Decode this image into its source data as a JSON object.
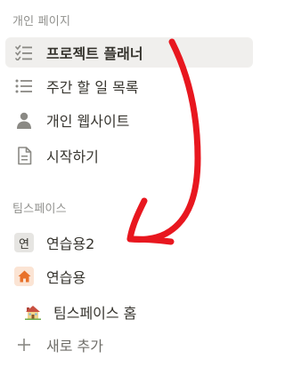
{
  "personal": {
    "title": "개인 페이지",
    "items": [
      {
        "label": "프로젝트 플래너",
        "icon": "checklist-icon"
      },
      {
        "label": "주간 할 일 목록",
        "icon": "bullet-list-icon"
      },
      {
        "label": "개인 웹사이트",
        "icon": "person-icon"
      },
      {
        "label": "시작하기",
        "icon": "document-icon"
      }
    ]
  },
  "teamspace": {
    "title": "팀스페이스",
    "items": [
      {
        "label": "연습용2",
        "icon": "teamspace-initial-badge-icon",
        "badge_text": "연"
      },
      {
        "label": "연습용",
        "icon": "house-badge-icon"
      },
      {
        "label": "팀스페이스 홈",
        "icon": "home-emoji-icon"
      },
      {
        "label": "새로 추가",
        "icon": "plus-icon"
      }
    ]
  },
  "colors": {
    "selected_bg": "#f0efed",
    "annotation_arrow": "#e8171f",
    "orange_badge": "#fbe4d4",
    "house_orange": "#e8712a"
  }
}
